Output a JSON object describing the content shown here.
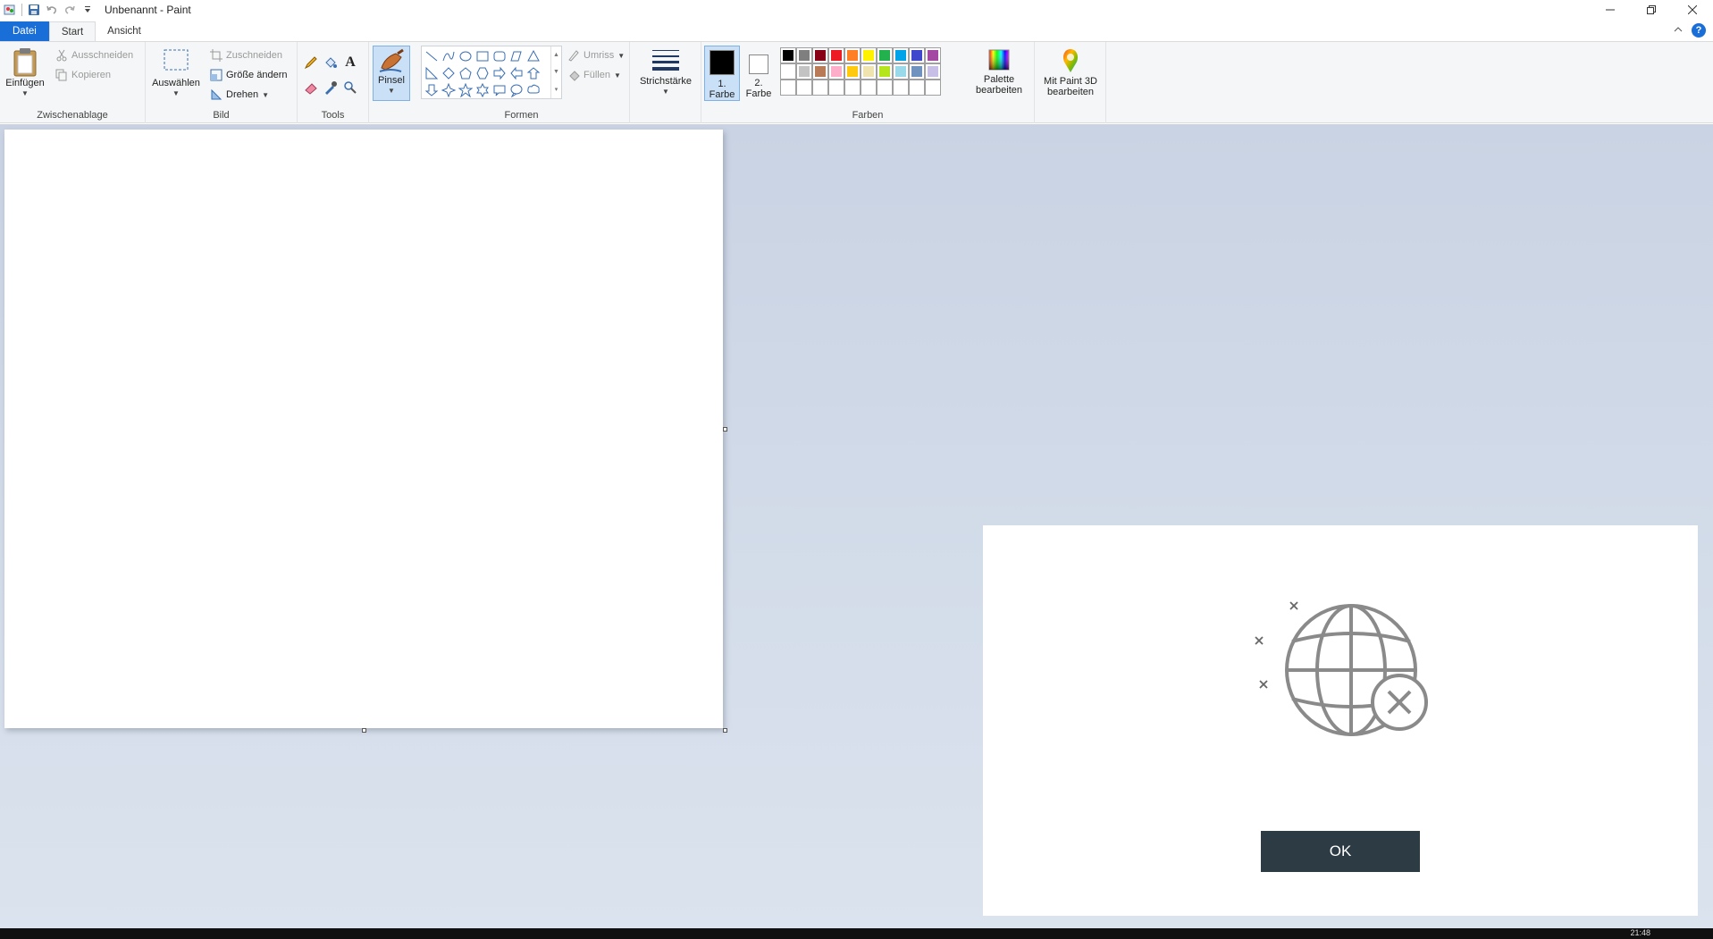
{
  "window": {
    "title": "Unbenannt - Paint"
  },
  "tabs": {
    "file": "Datei",
    "start": "Start",
    "view": "Ansicht"
  },
  "ribbon": {
    "clipboard": {
      "label": "Zwischenablage",
      "paste": "Einfügen",
      "cut": "Ausschneiden",
      "copy": "Kopieren"
    },
    "image": {
      "label": "Bild",
      "select": "Auswählen",
      "crop": "Zuschneiden",
      "resize": "Größe ändern",
      "rotate": "Drehen"
    },
    "tools": {
      "label": "Tools"
    },
    "brushes": {
      "label": "Pinsel"
    },
    "shapes": {
      "label": "Formen",
      "outline": "Umriss",
      "fill": "Füllen"
    },
    "size": {
      "label": "Strichstärke"
    },
    "colors": {
      "label": "Farben",
      "color1": "1. Farbe",
      "color2": "2. Farbe",
      "edit_palette": "Palette bearbeiten",
      "paint3d": "Mit Paint 3D bearbeiten",
      "palette_row1": [
        "#000000",
        "#7f7f7f",
        "#880015",
        "#ed1c24",
        "#ff7f27",
        "#fff200",
        "#22b14c",
        "#00a2e8",
        "#3f48cc",
        "#a349a4"
      ],
      "palette_row2": [
        "#ffffff",
        "#c3c3c3",
        "#b97a57",
        "#ffaec9",
        "#ffc90e",
        "#efe4b0",
        "#b5e61d",
        "#99d9ea",
        "#7092be",
        "#c8bfe7"
      ]
    }
  },
  "dialog": {
    "ok": "OK"
  },
  "taskbar": {
    "clock": "21:48"
  }
}
